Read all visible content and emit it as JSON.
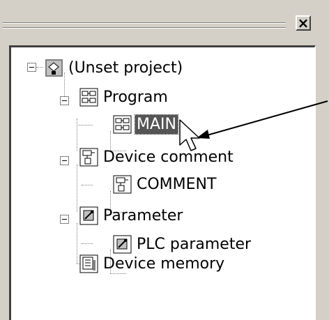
{
  "window": {
    "close_glyph": "×"
  },
  "tree": {
    "root": {
      "label": "(Unset project)",
      "icon": "project-icon"
    },
    "items": [
      {
        "label": "Program",
        "icon": "program-icon"
      },
      {
        "label": "MAIN",
        "icon": "program-icon",
        "selected": true
      },
      {
        "label": "Device comment",
        "icon": "device-comment-icon"
      },
      {
        "label": "COMMENT",
        "icon": "device-comment-icon"
      },
      {
        "label": "Parameter",
        "icon": "parameter-icon"
      },
      {
        "label": "PLC parameter",
        "icon": "parameter-icon"
      },
      {
        "label": "Device memory",
        "icon": "device-memory-icon"
      }
    ]
  },
  "colors": {
    "panel": "#d4d0c8",
    "selection": "#555555",
    "tree_background": "#ffffff"
  }
}
